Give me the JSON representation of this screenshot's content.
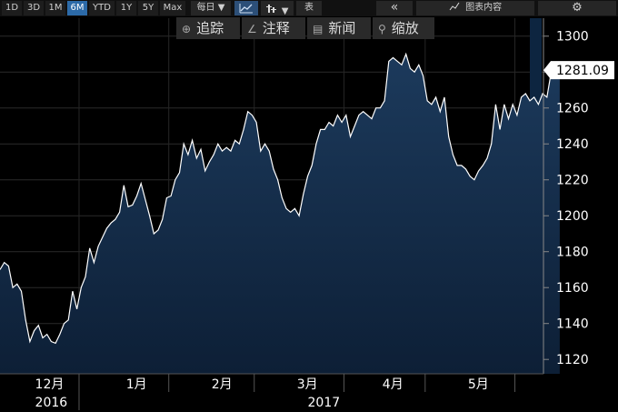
{
  "toolbar": {
    "periods": [
      "1D",
      "3D",
      "1M",
      "6M",
      "YTD",
      "1Y",
      "5Y",
      "Max"
    ],
    "active_period": "6M",
    "interval_label": "每日",
    "interval_arrow": "▼",
    "chart_type_icon": "line-chart-icon",
    "compare_icon": "bars-icon",
    "compare_arrow": "▼",
    "table_label": "表",
    "collapse_label": "«",
    "chart_content_label": "图表内容",
    "settings_icon": "gear-icon"
  },
  "overlay_toolbar": {
    "track_label": "追踪",
    "annotate_label": "注释",
    "news_label": "新闻",
    "zoom_label": "缩放"
  },
  "colors": {
    "background": "#000000",
    "area_fill_top": "#1c3a5c",
    "area_fill_bottom": "#0d1f36",
    "line": "#ffffff",
    "grid": "#2a2a2a",
    "active_button": "#2c6aa8",
    "future_band": "#0d2540"
  },
  "chart_data": {
    "type": "area",
    "ylim": [
      1112,
      1310
    ],
    "y_ticks": [
      1120,
      1140,
      1160,
      1180,
      1200,
      1220,
      1240,
      1260,
      1280,
      1300
    ],
    "last_value_label": "1281.09",
    "month_labels": [
      {
        "label": "12月",
        "x": 2.2
      },
      {
        "label": "1月",
        "x": 23.5
      },
      {
        "label": "2月",
        "x": 43.5
      },
      {
        "label": "3月",
        "x": 63.5
      },
      {
        "label": "4月",
        "x": 83.5
      },
      {
        "label": "5月",
        "x": 103.5
      }
    ],
    "month_boundaries": [
      12.5,
      33.5,
      53.5,
      74.5,
      93.5,
      114.5
    ],
    "year_labels": [
      {
        "label": "2016",
        "x": 2.2
      },
      {
        "label": "2017",
        "x": 66
      }
    ],
    "year_boundary": 12.5,
    "x_range": [
      -6,
      118
    ],
    "points": [
      [
        -6,
        1170
      ],
      [
        -5,
        1174
      ],
      [
        -4,
        1172
      ],
      [
        -3,
        1160
      ],
      [
        -2,
        1162
      ],
      [
        -1,
        1158
      ],
      [
        0,
        1142
      ],
      [
        1,
        1130
      ],
      [
        2,
        1136
      ],
      [
        3,
        1139
      ],
      [
        4,
        1132
      ],
      [
        5,
        1134
      ],
      [
        6,
        1130
      ],
      [
        7,
        1129
      ],
      [
        8,
        1134
      ],
      [
        9,
        1140
      ],
      [
        10,
        1142
      ],
      [
        11,
        1158
      ],
      [
        12,
        1148
      ],
      [
        13,
        1160
      ],
      [
        14,
        1166
      ],
      [
        15,
        1182
      ],
      [
        16,
        1174
      ],
      [
        17,
        1183
      ],
      [
        18,
        1188
      ],
      [
        19,
        1193
      ],
      [
        20,
        1196
      ],
      [
        21,
        1198
      ],
      [
        22,
        1202
      ],
      [
        23,
        1217
      ],
      [
        24,
        1205
      ],
      [
        25,
        1206
      ],
      [
        26,
        1211
      ],
      [
        27,
        1218
      ],
      [
        28,
        1209
      ],
      [
        29,
        1200
      ],
      [
        30,
        1190
      ],
      [
        31,
        1192
      ],
      [
        32,
        1198
      ],
      [
        33,
        1210
      ],
      [
        34,
        1211
      ],
      [
        35,
        1220
      ],
      [
        36,
        1224
      ],
      [
        37,
        1240
      ],
      [
        38,
        1234
      ],
      [
        39,
        1242
      ],
      [
        40,
        1232
      ],
      [
        41,
        1237
      ],
      [
        42,
        1225
      ],
      [
        43,
        1230
      ],
      [
        44,
        1234
      ],
      [
        45,
        1240
      ],
      [
        46,
        1236
      ],
      [
        47,
        1238
      ],
      [
        48,
        1236
      ],
      [
        49,
        1242
      ],
      [
        50,
        1240
      ],
      [
        51,
        1248
      ],
      [
        52,
        1258
      ],
      [
        53,
        1256
      ],
      [
        54,
        1252
      ],
      [
        55,
        1236
      ],
      [
        56,
        1240
      ],
      [
        57,
        1236
      ],
      [
        58,
        1226
      ],
      [
        59,
        1220
      ],
      [
        60,
        1210
      ],
      [
        61,
        1204
      ],
      [
        62,
        1202
      ],
      [
        63,
        1204
      ],
      [
        64,
        1200
      ],
      [
        65,
        1212
      ],
      [
        66,
        1222
      ],
      [
        67,
        1228
      ],
      [
        68,
        1240
      ],
      [
        69,
        1248
      ],
      [
        70,
        1248
      ],
      [
        71,
        1252
      ],
      [
        72,
        1250
      ],
      [
        73,
        1256
      ],
      [
        74,
        1252
      ],
      [
        75,
        1256
      ],
      [
        76,
        1244
      ],
      [
        77,
        1250
      ],
      [
        78,
        1256
      ],
      [
        79,
        1258
      ],
      [
        80,
        1256
      ],
      [
        81,
        1254
      ],
      [
        82,
        1260
      ],
      [
        83,
        1260
      ],
      [
        84,
        1264
      ],
      [
        85,
        1286
      ],
      [
        86,
        1288
      ],
      [
        87,
        1286
      ],
      [
        88,
        1284
      ],
      [
        89,
        1290
      ],
      [
        90,
        1282
      ],
      [
        91,
        1280
      ],
      [
        92,
        1284
      ],
      [
        93,
        1278
      ],
      [
        94,
        1264
      ],
      [
        95,
        1262
      ],
      [
        96,
        1266
      ],
      [
        97,
        1258
      ],
      [
        98,
        1266
      ],
      [
        99,
        1244
      ],
      [
        100,
        1234
      ],
      [
        101,
        1228
      ],
      [
        102,
        1228
      ],
      [
        103,
        1226
      ],
      [
        104,
        1222
      ],
      [
        105,
        1220
      ],
      [
        106,
        1225
      ],
      [
        107,
        1228
      ],
      [
        108,
        1232
      ],
      [
        109,
        1240
      ],
      [
        110,
        1262
      ],
      [
        111,
        1248
      ],
      [
        112,
        1262
      ],
      [
        113,
        1254
      ],
      [
        114,
        1262
      ],
      [
        115,
        1256
      ],
      [
        116,
        1266
      ],
      [
        117,
        1268
      ],
      [
        118,
        1264
      ],
      [
        119,
        1266
      ],
      [
        120,
        1262
      ],
      [
        121,
        1268
      ],
      [
        122,
        1266
      ],
      [
        123,
        1280
      ],
      [
        124,
        1280
      ],
      [
        125,
        1281.09
      ]
    ]
  }
}
